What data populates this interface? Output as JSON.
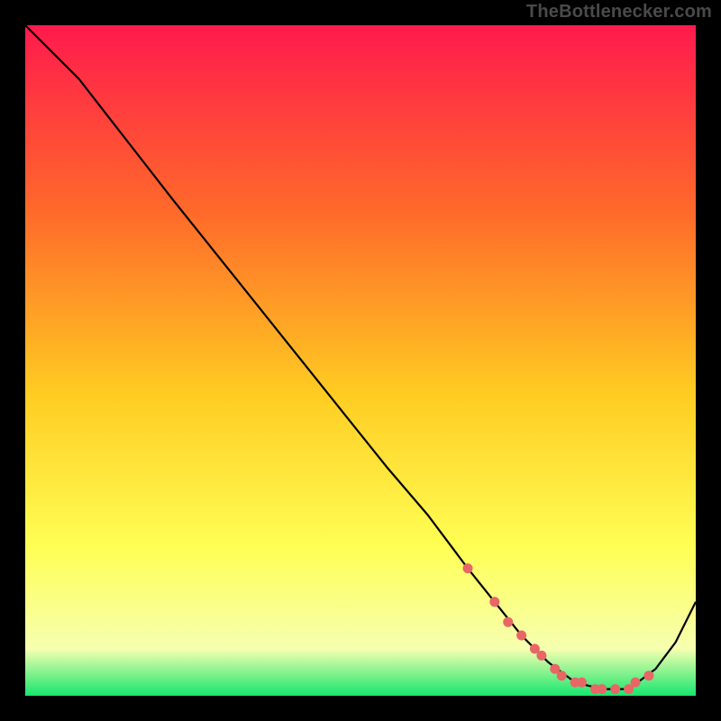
{
  "attribution": "TheBottlenecker.com",
  "colors": {
    "bg_black": "#000000",
    "grad_top": "#ff1a4d",
    "grad_mid1": "#ff6a2a",
    "grad_mid2": "#ffcc22",
    "grad_mid3": "#ffff55",
    "grad_mid4": "#f6ffb0",
    "grad_bottom": "#17e66e",
    "curve": "#000000",
    "marker": "#e86666"
  },
  "chart_data": {
    "type": "line",
    "title": "",
    "xlabel": "",
    "ylabel": "",
    "xlim": [
      0,
      100
    ],
    "ylim": [
      0,
      100
    ],
    "series": [
      {
        "name": "curve",
        "x": [
          0,
          8,
          15,
          22,
          30,
          38,
          46,
          54,
          60,
          66,
          70,
          74,
          78,
          82,
          86,
          90,
          94,
          97,
          100
        ],
        "y": [
          100,
          92,
          83,
          74,
          64,
          54,
          44,
          34,
          27,
          19,
          14,
          9,
          5,
          2,
          1,
          1,
          4,
          8,
          14
        ]
      }
    ],
    "markers": {
      "name": "bottleneck-points",
      "x": [
        66,
        70,
        72,
        74,
        76,
        77,
        79,
        80,
        82,
        83,
        85,
        86,
        88,
        90,
        91,
        93
      ],
      "y": [
        19,
        14,
        11,
        9,
        7,
        6,
        4,
        3,
        2,
        2,
        1,
        1,
        1,
        1,
        2,
        3
      ]
    }
  }
}
